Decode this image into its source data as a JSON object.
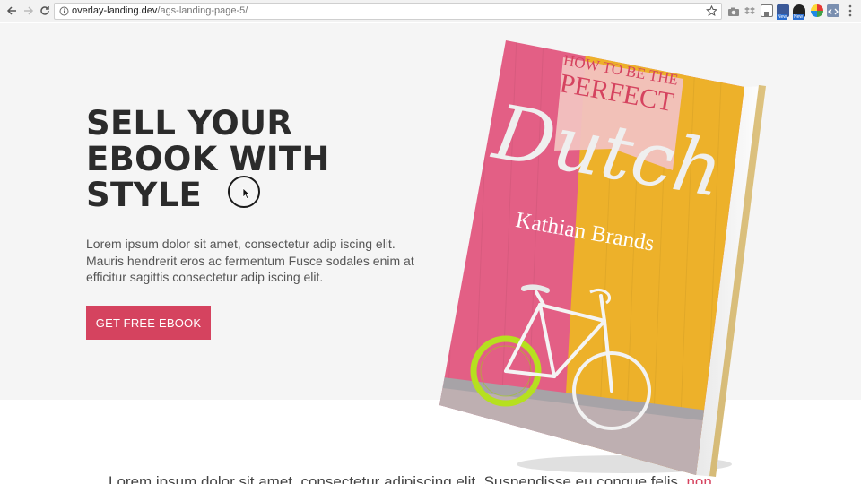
{
  "browser": {
    "url_host": "overlay-landing.dev",
    "url_path": "/ags-landing-page-5/",
    "extensions": [
      {
        "icon": "camera-icon"
      },
      {
        "icon": "dropbox-icon"
      },
      {
        "icon": "tab-icon"
      },
      {
        "icon": "extension-new-icon",
        "badge": "New"
      },
      {
        "icon": "extension-new-icon",
        "badge": "New"
      },
      {
        "icon": "color-wheel-icon"
      },
      {
        "icon": "code-icon"
      },
      {
        "icon": "grid-icon"
      }
    ]
  },
  "hero": {
    "title_lines": [
      "SELL YOUR",
      "EBOOK WITH",
      "STYLE"
    ],
    "description": "Lorem ipsum dolor sit amet, consectetur adip iscing elit. Mauris hendrerit eros ac fermentum Fusce sodales enim at efficitur sagittis consectetur adip iscing elit.",
    "cta_label": "GET FREE EBOOK"
  },
  "book": {
    "top_line": "HOW TO BE THE",
    "subtitle": "PERFECT",
    "title": "Dutch",
    "author": "Kathian Brands"
  },
  "section2": {
    "text": "Lorem ipsum dolor sit amet, consectetur adipiscing elit. Suspendisse eu congue felis,",
    "link_text": "non"
  },
  "colors": {
    "accent": "#d5435f",
    "hero_bg": "#f5f5f5",
    "book_pink": "#e35f85",
    "book_yellow": "#edb12a"
  }
}
